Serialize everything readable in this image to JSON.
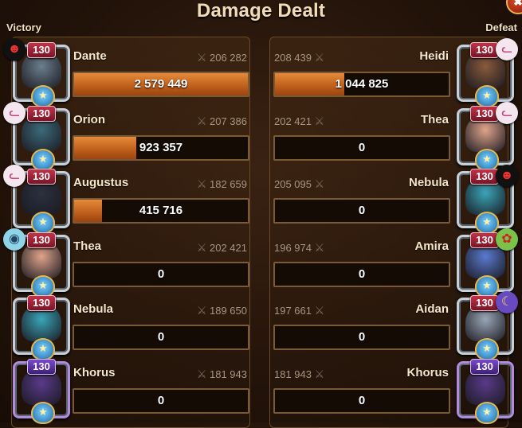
{
  "title": "Damage Dealt",
  "left_label": "Victory",
  "right_label": "Defeat",
  "close_icon": "✖",
  "colors": {
    "bar_fill": "#c1611c",
    "level_red": "#c2334a",
    "level_purple": "#7a4ac8"
  },
  "left_team": [
    {
      "name": "Dante",
      "level": "130",
      "power": "206 282",
      "damage": "2 579 449",
      "damage_fraction": 1.0,
      "tier": "red",
      "badge_icon": "black-mask-icon",
      "face": "#6b7f8c"
    },
    {
      "name": "Orion",
      "level": "130",
      "power": "207 386",
      "damage": "923 357",
      "damage_fraction": 0.36,
      "tier": "red",
      "badge_icon": "cat-icon",
      "face": "#3d6a7a"
    },
    {
      "name": "Augustus",
      "level": "130",
      "power": "182 659",
      "damage": "415 716",
      "damage_fraction": 0.16,
      "tier": "red",
      "badge_icon": "cat-icon",
      "face": "#2c3140"
    },
    {
      "name": "Thea",
      "level": "130",
      "power": "202 421",
      "damage": "0",
      "damage_fraction": 0,
      "tier": "red",
      "badge_icon": "fish-icon",
      "face": "#e0a48a"
    },
    {
      "name": "Nebula",
      "level": "130",
      "power": "189 650",
      "damage": "0",
      "damage_fraction": 0,
      "tier": "red",
      "badge_icon": "",
      "face": "#3aa5b8"
    },
    {
      "name": "Khorus",
      "level": "130",
      "power": "181 943",
      "damage": "0",
      "damage_fraction": 0,
      "tier": "purple",
      "badge_icon": "",
      "face": "#5a3a8a"
    }
  ],
  "right_team": [
    {
      "name": "Heidi",
      "level": "130",
      "power": "208 439",
      "damage": "1 044 825",
      "damage_fraction": 0.4,
      "tier": "red",
      "badge_icon": "cat-icon",
      "face": "#8a5a3a"
    },
    {
      "name": "Thea",
      "level": "130",
      "power": "202 421",
      "damage": "0",
      "damage_fraction": 0,
      "tier": "red",
      "badge_icon": "cat-icon",
      "face": "#e0a48a"
    },
    {
      "name": "Nebula",
      "level": "130",
      "power": "205 095",
      "damage": "0",
      "damage_fraction": 0,
      "tier": "red",
      "badge_icon": "black-mask-icon",
      "face": "#3aa5b8"
    },
    {
      "name": "Amira",
      "level": "130",
      "power": "196 974",
      "damage": "0",
      "damage_fraction": 0,
      "tier": "red",
      "badge_icon": "green-bug-icon",
      "face": "#5a7ad0"
    },
    {
      "name": "Aidan",
      "level": "130",
      "power": "197 661",
      "damage": "0",
      "damage_fraction": 0,
      "tier": "red",
      "badge_icon": "moon-icon",
      "face": "#9aa6b6"
    },
    {
      "name": "Khorus",
      "level": "130",
      "power": "181 943",
      "damage": "0",
      "damage_fraction": 0,
      "tier": "purple",
      "badge_icon": "",
      "face": "#5a3a8a"
    }
  ]
}
